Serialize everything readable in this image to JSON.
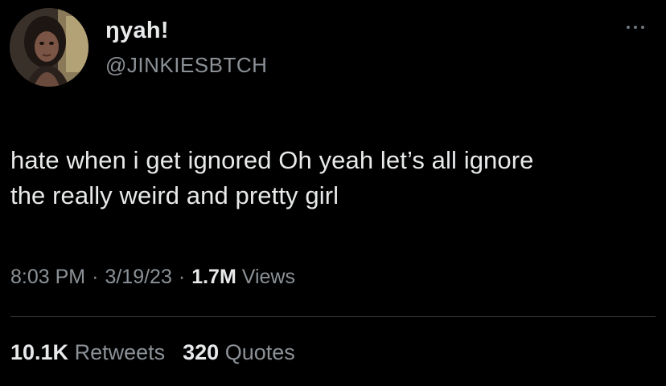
{
  "tweet": {
    "display_name": "ŋyah!",
    "handle": "@JINKIESBTCH",
    "text_line1": "hate when i get ignored Oh yeah let’s all ignore",
    "text_line2": "the really weird and pretty girl",
    "time": "8:03 PM",
    "separator": "·",
    "date": "3/19/23",
    "views_count": "1.7M",
    "views_label": "Views",
    "retweets_count": "10.1K",
    "retweets_label": "Retweets",
    "quotes_count": "320",
    "quotes_label": "Quotes",
    "more_icon": "more-horizontal-icon"
  },
  "colors": {
    "background": "#000000",
    "primary_text": "#e7e9ea",
    "secondary_text": "#8b9196",
    "divider": "#2f3336"
  }
}
